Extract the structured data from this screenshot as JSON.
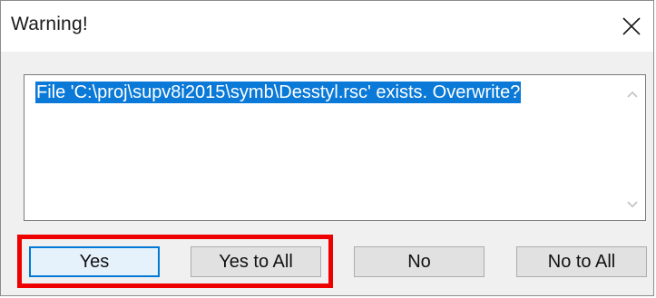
{
  "window": {
    "title": "Warning!"
  },
  "message": {
    "text": "File 'C:\\proj\\supv8i2015\\symb\\Desstyl.rsc' exists. Overwrite?"
  },
  "buttons": {
    "yes": "Yes",
    "yes_to_all": "Yes to All",
    "no": "No",
    "no_to_all": "No to All"
  },
  "icons": {
    "close": "close-icon",
    "scroll_up": "chevron-up-icon",
    "scroll_down": "chevron-down-icon"
  },
  "colors": {
    "selection": "#0a79d7",
    "highlight_box": "#ee0000",
    "default_button_border": "#0078d7"
  }
}
